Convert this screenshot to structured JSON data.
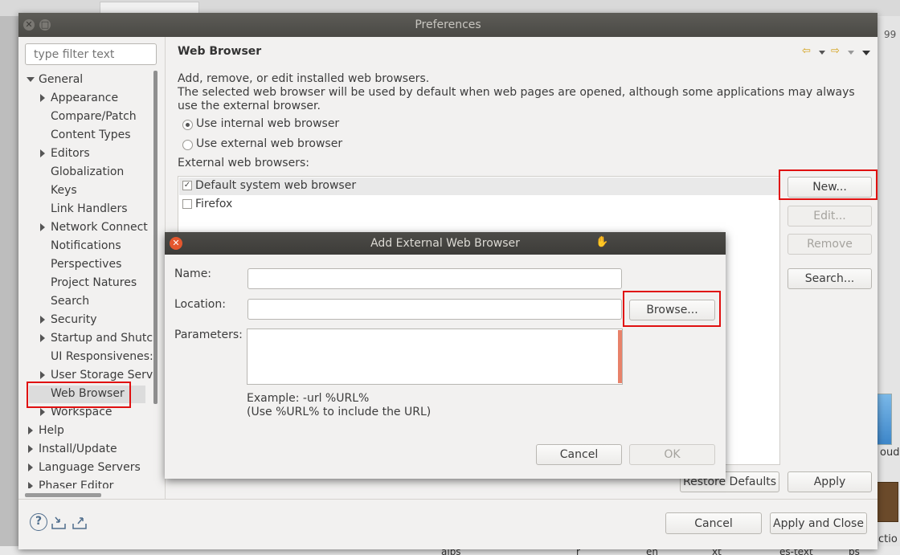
{
  "background": {
    "right_number": "99",
    "right_word_1": "ouds",
    "right_word_2": "ctio",
    "bottom_texts": [
      "aips",
      "r",
      "en",
      "xt",
      "es-text",
      "ps"
    ]
  },
  "window": {
    "title": "Preferences"
  },
  "filter": {
    "placeholder": "type filter text"
  },
  "tree": {
    "items": [
      {
        "label": "General",
        "level": 0,
        "expander": "down"
      },
      {
        "label": "Appearance",
        "level": 1,
        "expander": "right"
      },
      {
        "label": "Compare/Patch",
        "level": 1,
        "expander": "none"
      },
      {
        "label": "Content Types",
        "level": 1,
        "expander": "none"
      },
      {
        "label": "Editors",
        "level": 1,
        "expander": "right"
      },
      {
        "label": "Globalization",
        "level": 1,
        "expander": "none"
      },
      {
        "label": "Keys",
        "level": 1,
        "expander": "none"
      },
      {
        "label": "Link Handlers",
        "level": 1,
        "expander": "none"
      },
      {
        "label": "Network Connect",
        "level": 1,
        "expander": "right"
      },
      {
        "label": "Notifications",
        "level": 1,
        "expander": "none"
      },
      {
        "label": "Perspectives",
        "level": 1,
        "expander": "none"
      },
      {
        "label": "Project Natures",
        "level": 1,
        "expander": "none"
      },
      {
        "label": "Search",
        "level": 1,
        "expander": "none"
      },
      {
        "label": "Security",
        "level": 1,
        "expander": "right"
      },
      {
        "label": "Startup and Shutc",
        "level": 1,
        "expander": "right"
      },
      {
        "label": "UI Responsivenes:",
        "level": 1,
        "expander": "none"
      },
      {
        "label": "User Storage Serv",
        "level": 1,
        "expander": "right"
      },
      {
        "label": "Web Browser",
        "level": 1,
        "expander": "none",
        "selected": true
      },
      {
        "label": "Workspace",
        "level": 1,
        "expander": "right"
      },
      {
        "label": "Help",
        "level": 0,
        "expander": "right"
      },
      {
        "label": "Install/Update",
        "level": 0,
        "expander": "right"
      },
      {
        "label": "Language Servers",
        "level": 0,
        "expander": "right"
      },
      {
        "label": "Phaser Editor",
        "level": 0,
        "expander": "right"
      }
    ]
  },
  "page": {
    "title": "Web Browser",
    "desc_line1": "Add, remove, or edit installed web browsers.",
    "desc_line2": "The selected web browser will be used by default when web pages are opened, although some applications may always use the external browser.",
    "radio_internal": "Use internal web browser",
    "radio_external": "Use external web browser",
    "selected_mode": "internal",
    "external_label": "External web browsers:",
    "browsers": [
      {
        "name": "Default system web browser",
        "checked": true
      },
      {
        "name": "Firefox",
        "checked": false
      }
    ],
    "buttons": {
      "new": "New...",
      "edit": "Edit...",
      "remove": "Remove",
      "search": "Search..."
    },
    "restore_defaults": "Restore Defaults",
    "apply": "Apply"
  },
  "footer": {
    "cancel": "Cancel",
    "apply_close": "Apply and Close"
  },
  "dialog": {
    "title": "Add External Web Browser",
    "name_label": "Name:",
    "name_value": "",
    "location_label": "Location:",
    "location_value": "",
    "browse": "Browse...",
    "params_label": "Parameters:",
    "params_value": "",
    "example": "Example: -url %URL%",
    "example_note": "(Use %URL% to include the URL)",
    "cancel": "Cancel",
    "ok": "OK"
  },
  "colors": {
    "highlight_box": "#e01010",
    "titlebar": "#4f4e4a",
    "accent_orange": "#e8826a"
  }
}
